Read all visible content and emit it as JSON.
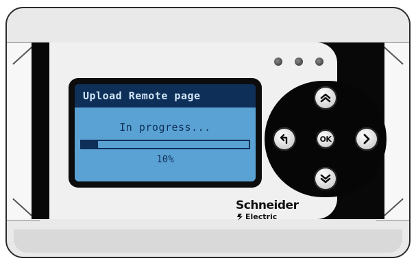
{
  "screen": {
    "title": "Upload Remote page",
    "status": "In progress...",
    "progress": {
      "percent": 10,
      "label": "10%"
    }
  },
  "keypad": {
    "up_icon": "double-chevron-up-icon",
    "down_icon": "double-chevron-down-icon",
    "back_icon": "back-arrow-icon",
    "right_icon": "chevron-right-icon",
    "ok_label": "OK"
  },
  "brand": {
    "name": "Schneider",
    "sub": "Electric"
  },
  "colors": {
    "screen_bg": "#5aa2d4",
    "screen_text": "#0e2f58",
    "title_bar": "#0e2f58",
    "title_text": "#cfe4f5"
  }
}
